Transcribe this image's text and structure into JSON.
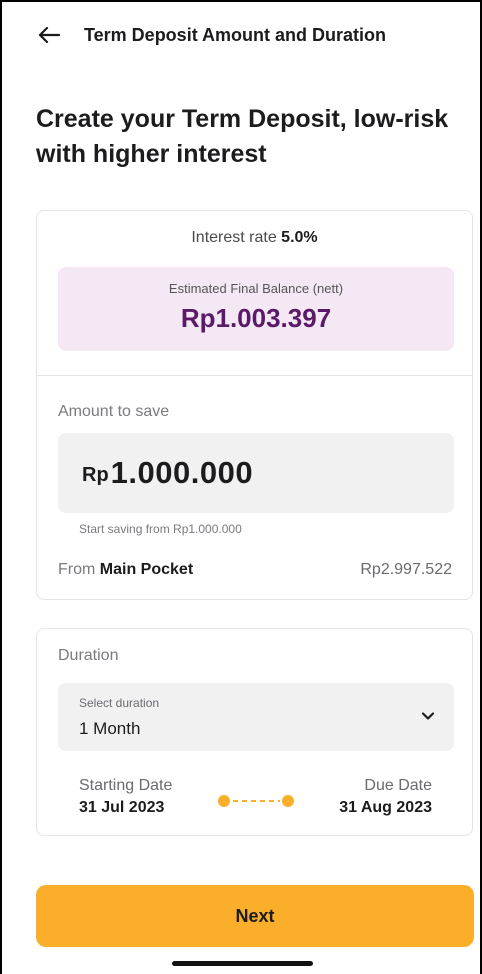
{
  "header": {
    "title": "Term Deposit Amount and Duration",
    "back_icon": "arrow-left-icon"
  },
  "page_title": "Create your Term Deposit, low-risk with higher interest",
  "summary": {
    "interest_prefix": "Interest rate",
    "interest_rate": "5.0%",
    "estimated_label": "Estimated Final Balance (nett)",
    "estimated_value": "Rp1.003.397",
    "accent_color": "#5a1a68",
    "highlight_bg": "#f4e8f4"
  },
  "amount": {
    "label": "Amount to save",
    "currency": "Rp",
    "value": "1.000.000",
    "hint": "Start saving from Rp1.000.000"
  },
  "source": {
    "prefix": "From",
    "pocket_name": "Main Pocket",
    "balance": "Rp2.997.522"
  },
  "duration": {
    "label": "Duration",
    "select_label": "Select duration",
    "selected": "1 Month",
    "chevron_icon": "chevron-down-icon",
    "start_label": "Starting Date",
    "start_date": "31 Jul 2023",
    "end_label": "Due Date",
    "end_date": "31 Aug 2023",
    "timeline_color": "#fbae2a"
  },
  "actions": {
    "next_label": "Next",
    "primary_color": "#fbae2a"
  }
}
